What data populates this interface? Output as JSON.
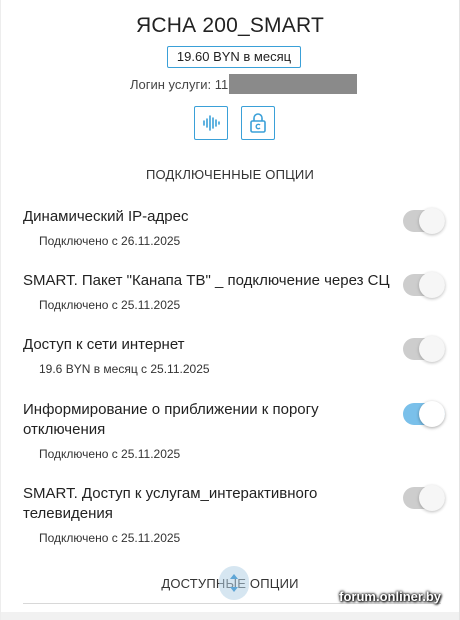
{
  "plan": {
    "title": "ЯСНА 200_SMART",
    "price": "19.60 BYN в месяц",
    "login_label": "Логин услуги: 11"
  },
  "actions": {
    "voice_icon": "waveform-icon",
    "lock_icon": "lock-icon"
  },
  "sections": {
    "connected_title": "ПОДКЛЮЧЕННЫЕ ОПЦИИ",
    "available_title": "ДОСТУПНЫЕ ОПЦИИ"
  },
  "options": [
    {
      "title": "Динамический IP-адрес",
      "subtitle": "Подключено с 26.11.2025",
      "enabled": false
    },
    {
      "title": "SMART. Пакет \"Канапа ТВ\" _ подключение через СЦ",
      "subtitle": "Подключено с 25.11.2025",
      "enabled": false
    },
    {
      "title": "Доступ к сети интернет",
      "subtitle": "19.6 BYN в месяц с 25.11.2025",
      "enabled": false
    },
    {
      "title": "Информирование о приближении к порогу отключения",
      "subtitle": "Подключено с 25.11.2025",
      "enabled": true
    },
    {
      "title": "SMART. Доступ к услугам_интерактивного телевидения",
      "subtitle": "Подключено с 25.11.2025",
      "enabled": false
    }
  ],
  "watermark": "forum.onliner.by",
  "colors": {
    "accent": "#3aa0d8",
    "toggle_on": "#7ac0ea",
    "toggle_off": "#bdbdbd"
  }
}
